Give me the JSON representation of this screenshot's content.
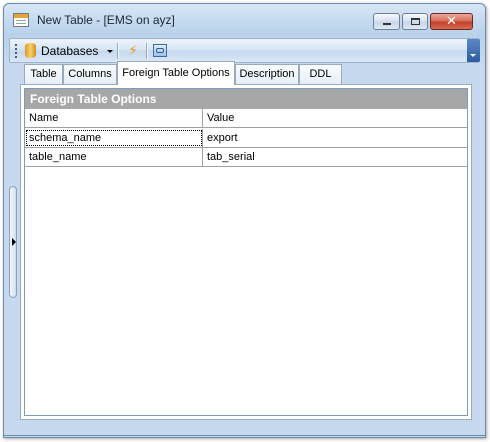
{
  "window": {
    "title": "New Table - [EMS on ayz]"
  },
  "toolbar": {
    "databases_label": "Databases"
  },
  "tabs": [
    {
      "label": "Table",
      "active": false
    },
    {
      "label": "Columns",
      "active": false
    },
    {
      "label": "Foreign Table Options",
      "active": true
    },
    {
      "label": "Description",
      "active": false
    },
    {
      "label": "DDL",
      "active": false
    }
  ],
  "grid": {
    "caption": "Foreign Table Options",
    "columns": [
      "Name",
      "Value"
    ],
    "rows": [
      {
        "name": "schema_name",
        "value": "export"
      },
      {
        "name": "table_name",
        "value": "tab_serial"
      }
    ]
  },
  "colors": {
    "caption_bg": "#a7a7a7",
    "window_chrome": "#c6d9ee",
    "close_button": "#c3412e"
  },
  "icons": [
    "app-table-icon",
    "database-icon",
    "lightning-icon",
    "refresh-icon",
    "chevron-down-icon",
    "splitter-arrow-icon"
  ]
}
